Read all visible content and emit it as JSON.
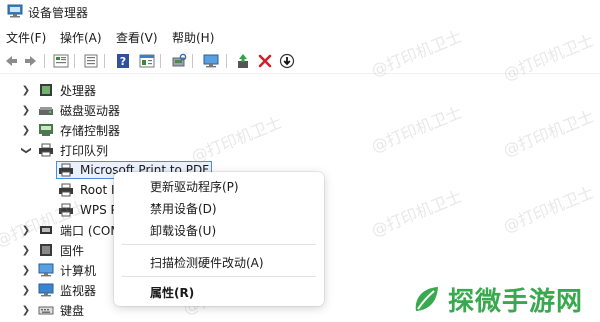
{
  "window": {
    "title": "设备管理器"
  },
  "menu": [
    "文件(F)",
    "操作(A)",
    "查看(V)",
    "帮助(H)"
  ],
  "toolbar": {
    "buttons": [
      "back-icon",
      "forward-icon",
      "device-view-icon",
      "properties-icon",
      "help-icon",
      "resources-icon",
      "scan-hardware-icon",
      "monitor-icon",
      "update-driver-icon",
      "uninstall-icon",
      "disable-icon"
    ]
  },
  "tree": [
    {
      "label": "处理器",
      "expanded": false,
      "icon": "cpu-icon"
    },
    {
      "label": "磁盘驱动器",
      "expanded": false,
      "icon": "disk-drive-icon"
    },
    {
      "label": "存储控制器",
      "expanded": false,
      "icon": "storage-controller-icon"
    },
    {
      "label": "打印队列",
      "expanded": true,
      "icon": "printer-queue-icon"
    },
    {
      "label": "Microsoft Print to PDF",
      "icon": "printer-icon",
      "selected": true
    },
    {
      "label": "Root I",
      "icon": "printer-icon"
    },
    {
      "label": "WPS P",
      "icon": "printer-icon"
    },
    {
      "label": "端口 (COM",
      "expanded": false,
      "icon": "port-icon"
    },
    {
      "label": "固件",
      "expanded": false,
      "icon": "firmware-icon"
    },
    {
      "label": "计算机",
      "expanded": false,
      "icon": "computer-icon"
    },
    {
      "label": "监视器",
      "expanded": false,
      "icon": "monitor-icon"
    },
    {
      "label": "键盘",
      "expanded": false,
      "icon": "keyboard-icon"
    }
  ],
  "context_menu": {
    "items": [
      "更新驱动程序(P)",
      "禁用设备(D)",
      "卸载设备(U)",
      "扫描检测硬件改动(A)",
      "属性(R)"
    ]
  },
  "watermark": "@打印机卫士",
  "logo": {
    "text": "探微手游网",
    "color": "#38a94e"
  }
}
